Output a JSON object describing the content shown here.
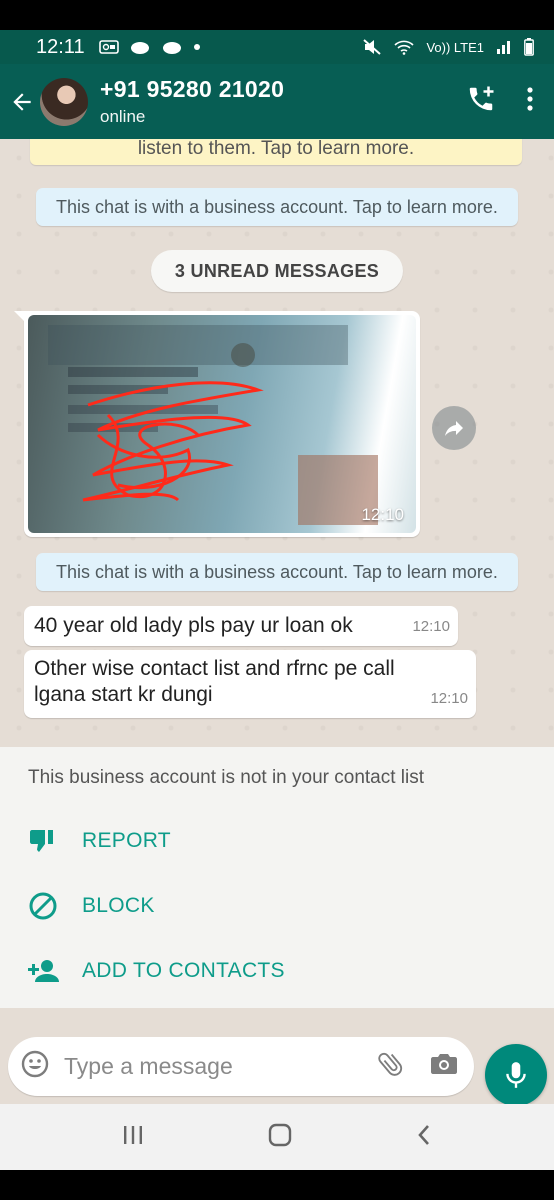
{
  "status_bar": {
    "time": "12:11",
    "network": "Vo)) LTE1"
  },
  "header": {
    "contact_name": "+91 95280 21020",
    "presence": "online"
  },
  "chat": {
    "yellow_banner": "listen to them. Tap to learn more.",
    "business_note_1": "This chat is with a business account. Tap to learn more.",
    "unread_label": "3 UNREAD MESSAGES",
    "image_message": {
      "time": "12:10",
      "image": "blurred-id-card-photo-with-red-scribble"
    },
    "business_note_2": "This chat is with a business account. Tap to learn more.",
    "messages": [
      {
        "text": "40 year old lady pls pay ur loan ok",
        "time": "12:10"
      },
      {
        "text": "Other wise contact list and rfrnc pe call lgana start kr dungi",
        "time": "12:10"
      }
    ]
  },
  "business_panel": {
    "caption": "This business account is not in your contact list",
    "actions": [
      {
        "label": "REPORT",
        "icon": "thumbs-down-icon"
      },
      {
        "label": "BLOCK",
        "icon": "block-icon"
      },
      {
        "label": "ADD TO CONTACTS",
        "icon": "add-person-icon"
      }
    ],
    "accent_color": "#0e9c8a"
  },
  "composer": {
    "placeholder": "Type a message"
  },
  "colors": {
    "header": "#075e54",
    "fab": "#00897b",
    "chat_bg": "#e5ddd5"
  }
}
